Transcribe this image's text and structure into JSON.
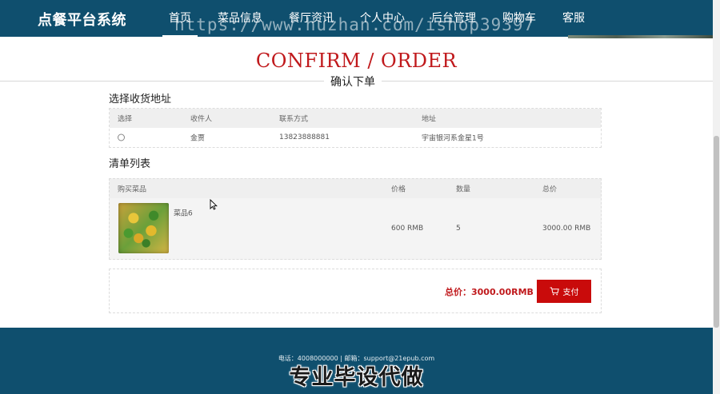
{
  "brand": "点餐平台系统",
  "nav": [
    "首页",
    "菜品信息",
    "餐厅资讯",
    "个人中心",
    "后台管理",
    "购物车",
    "客服"
  ],
  "watermark_url": "https://www.huzhan.com/ishop39397",
  "page_title": "CONFIRM / ORDER",
  "page_subtitle": "确认下单",
  "address_section": {
    "title": "选择收货地址",
    "headers": [
      "选择",
      "收件人",
      "联系方式",
      "地址"
    ],
    "rows": [
      {
        "recipient": "金贾",
        "phone": "13823888881",
        "address": "宇宙银河系金星1号"
      }
    ]
  },
  "order_section": {
    "title": "清单列表",
    "headers": [
      "购买菜品",
      "价格",
      "数量",
      "总价"
    ],
    "items": [
      {
        "name": "菜品6",
        "price": "600 RMB",
        "quantity": "5",
        "total": "3000.00 RMB"
      }
    ]
  },
  "summary": {
    "total_label": "总价：3000.00RMB",
    "pay_label": "支付"
  },
  "footer": {
    "contact": "电话：4008000000 | 邮箱：support@21epub.com",
    "watermark": "专业毕设代做"
  },
  "colors": {
    "nav_bg": "#0f4f6e",
    "accent_red": "#c0191c",
    "pay_button": "#c90b0b"
  }
}
